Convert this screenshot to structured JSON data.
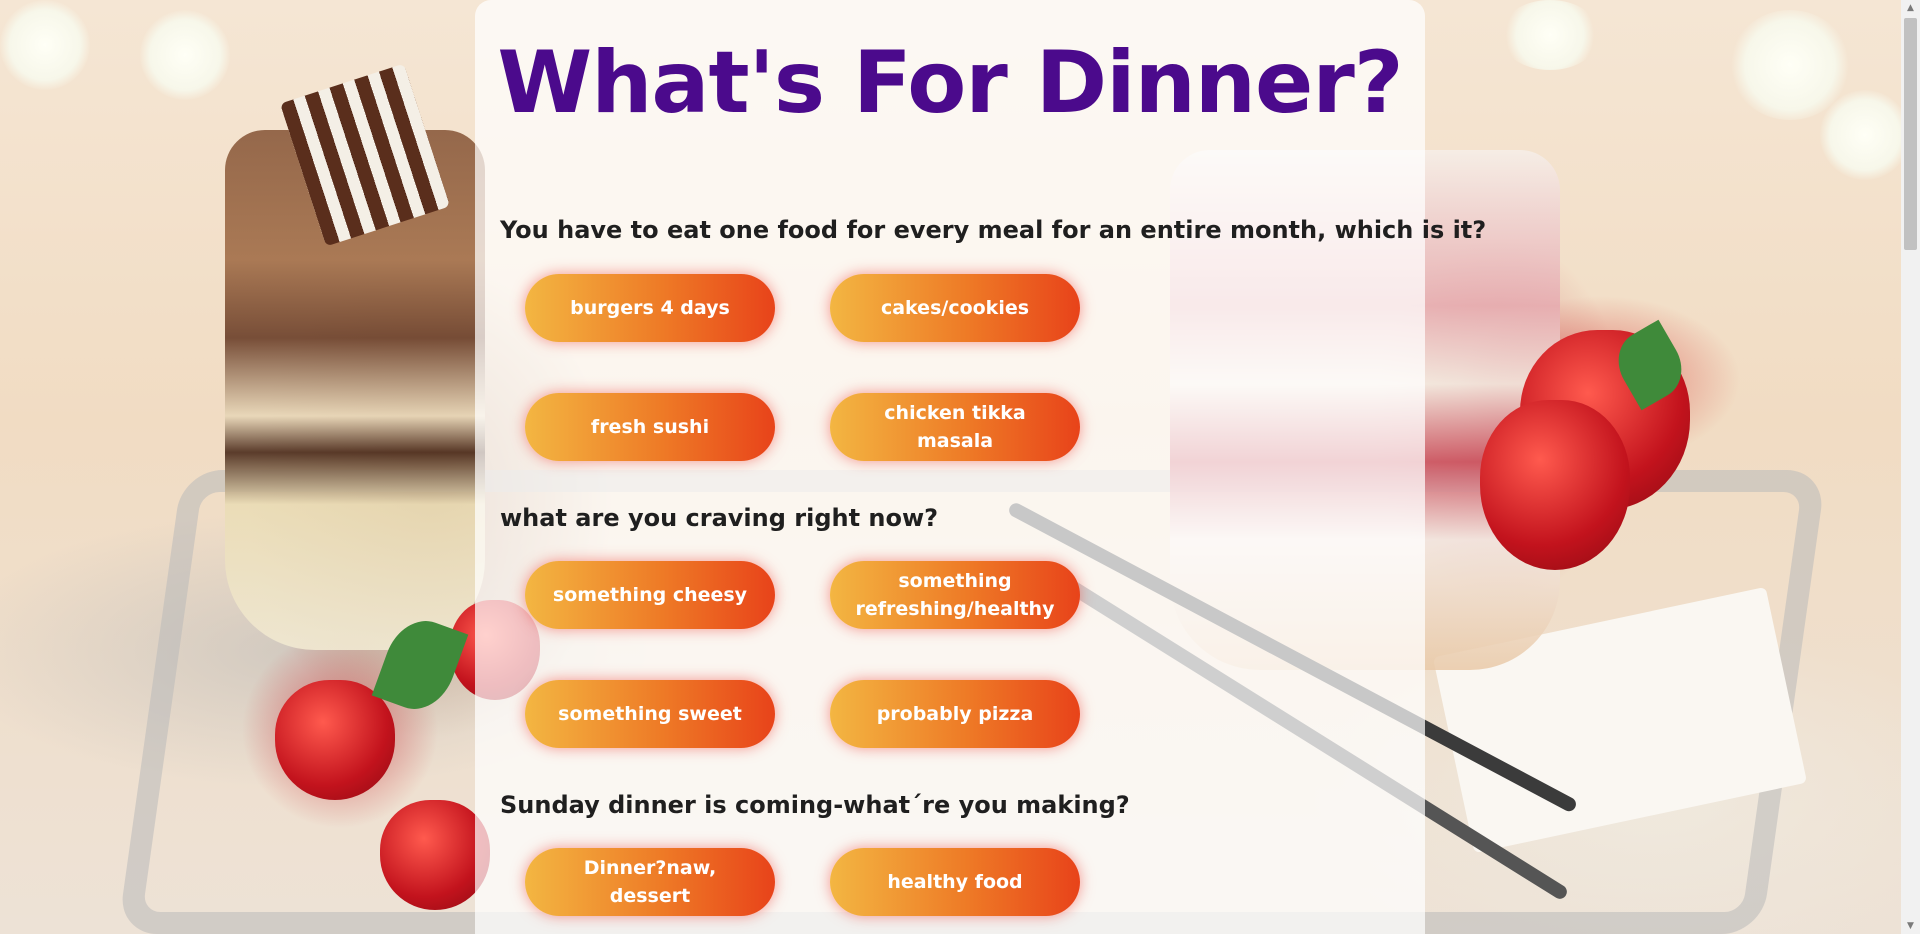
{
  "page": {
    "title": "What's For Dinner?"
  },
  "questions": [
    {
      "text": "You have to eat one food for every meal for an entire month, which is it?",
      "options": [
        "burgers 4 days",
        "cakes/cookies",
        "fresh sushi",
        "chicken tikka masala"
      ]
    },
    {
      "text": "what are you craving right now?",
      "options": [
        "something cheesy",
        "something refreshing/healthy",
        "something sweet",
        "probably pizza"
      ]
    },
    {
      "text": "Sunday dinner is coming-what´re you making?",
      "options": [
        "Dinner?naw, dessert",
        "healthy food"
      ]
    }
  ],
  "scrollbar": {
    "up_glyph": "▲",
    "down_glyph": "▼"
  },
  "colors": {
    "title": "#4b0a8c",
    "button_gradient_start": "#f3b642",
    "button_gradient_end": "#e8431a",
    "button_text": "#ffffff"
  }
}
